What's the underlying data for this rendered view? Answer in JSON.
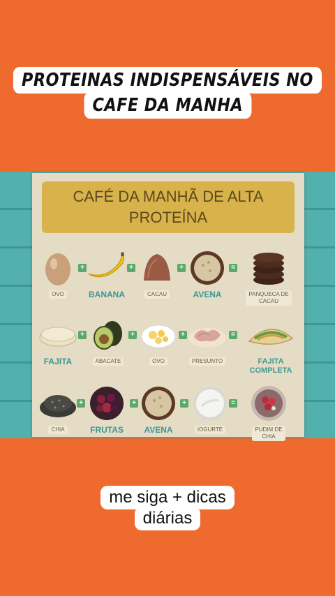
{
  "caption_top": [
    "PROTEINAS INDISPENSÁVEIS NO",
    "CAFE DA MANHA"
  ],
  "poster": {
    "title_lines": [
      "CAFÉ DA MANHÃ DE ALTA",
      "PROTEÍNA"
    ],
    "rows": [
      {
        "items": [
          {
            "label": "OVO",
            "big": false,
            "icon": "egg-icon"
          },
          {
            "label": "BANANA",
            "big": true,
            "icon": "banana-icon"
          },
          {
            "label": "CACAU",
            "big": false,
            "icon": "cocoa-icon"
          },
          {
            "label": "AVENA",
            "big": true,
            "icon": "oats-icon"
          }
        ],
        "result": {
          "label": [
            "PANQUECA DE",
            "CACAU"
          ],
          "big": false,
          "icon": "pancakes-icon"
        }
      },
      {
        "items": [
          {
            "label": "FAJITA",
            "big": true,
            "icon": "tortilla-icon"
          },
          {
            "label": "ABACATE",
            "big": false,
            "icon": "avocado-icon"
          },
          {
            "label": "OVO",
            "big": false,
            "icon": "scrambled-egg-icon"
          },
          {
            "label": "PRESUNTO",
            "big": false,
            "icon": "ham-icon"
          }
        ],
        "result": {
          "label": [
            "FAJITA",
            "COMPLETA"
          ],
          "big": true,
          "icon": "fajita-icon"
        }
      },
      {
        "items": [
          {
            "label": "CHIA",
            "big": false,
            "icon": "chia-icon"
          },
          {
            "label": "FRUTAS",
            "big": true,
            "icon": "berries-icon"
          },
          {
            "label": "AVENA",
            "big": true,
            "icon": "oats-icon"
          },
          {
            "label": "IOGURTE",
            "big": false,
            "icon": "yogurt-icon"
          }
        ],
        "result": {
          "label": [
            "PUDIM DE",
            "CHIA"
          ],
          "big": false,
          "icon": "chia-pudding-icon"
        }
      }
    ],
    "plus": "+",
    "equals": "="
  },
  "caption_bottom": [
    "me siga + dicas",
    "diárias"
  ]
}
